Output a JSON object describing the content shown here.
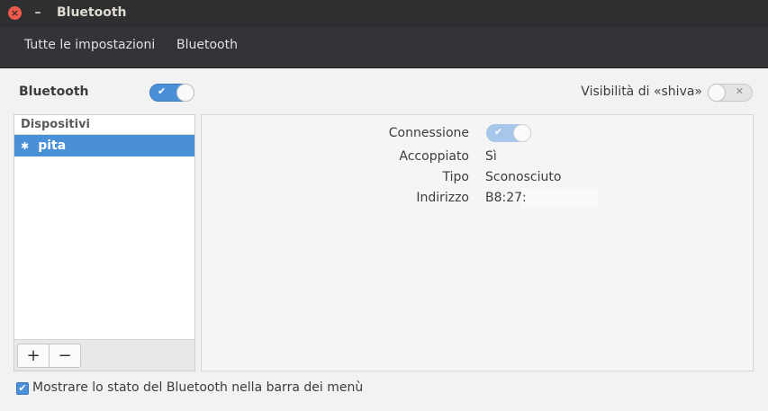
{
  "window": {
    "title": "Bluetooth",
    "close_glyph": "×",
    "minimize_glyph": "–"
  },
  "nav": {
    "all_settings": "Tutte le impostazioni",
    "current": "Bluetooth"
  },
  "main": {
    "bluetooth_label": "Bluetooth",
    "bluetooth_on": true,
    "visibility_label": "Visibilità di «shiva»",
    "visibility_on": false
  },
  "devices": {
    "header": "Dispositivi",
    "items": [
      {
        "name": "pita",
        "icon": "bluetooth-icon",
        "selected": true
      }
    ],
    "add_label": "+",
    "remove_label": "−"
  },
  "details": {
    "connection_label": "Connessione",
    "connection_on": true,
    "paired_label": "Accoppiato",
    "paired_value": "Sì",
    "type_label": "Tipo",
    "type_value": "Sconosciuto",
    "address_label": "Indirizzo",
    "address_value": "B8:27:"
  },
  "footer": {
    "show_status_label": "Mostrare lo stato del Bluetooth nella barra dei menù",
    "show_status_checked": true
  },
  "colors": {
    "accent": "#4a90d9",
    "titlebar": "#2e2f31",
    "close": "#f05a4a"
  }
}
